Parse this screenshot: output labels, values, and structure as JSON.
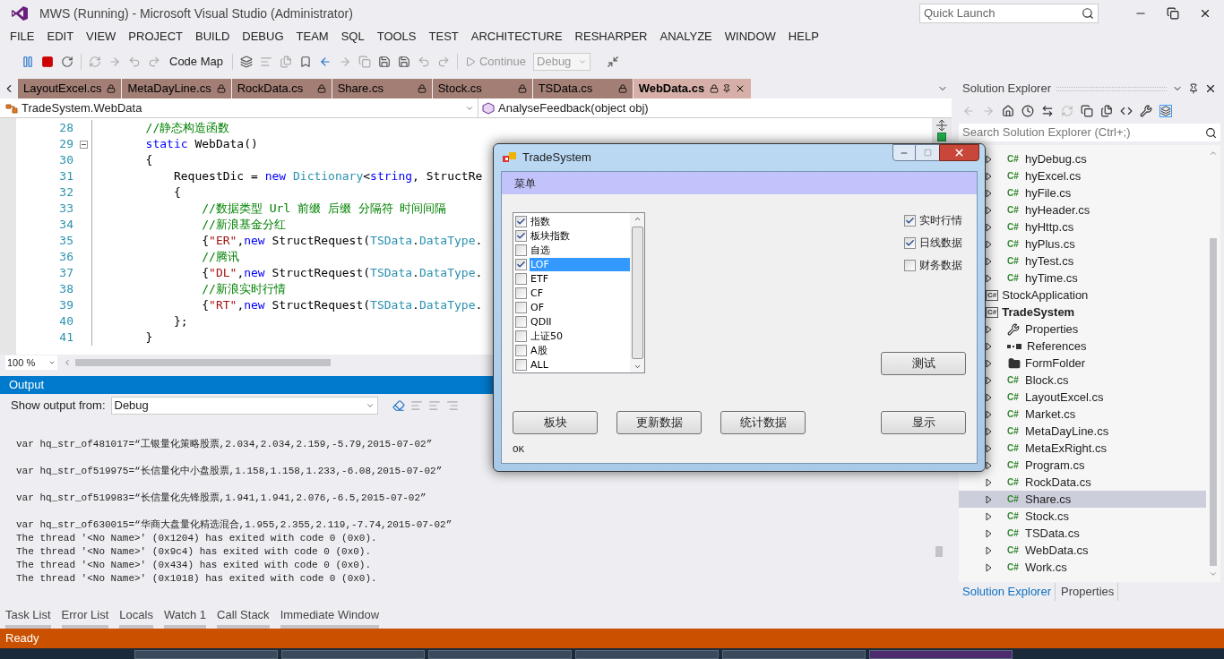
{
  "window": {
    "title": "MWS (Running) - Microsoft Visual Studio (Administrator)",
    "quick_launch": {
      "placeholder": "Quick Launch"
    }
  },
  "menu": [
    "FILE",
    "EDIT",
    "VIEW",
    "PROJECT",
    "BUILD",
    "DEBUG",
    "TEAM",
    "SQL",
    "TOOLS",
    "TEST",
    "ARCHITECTURE",
    "RESHARPER",
    "ANALYZE",
    "WINDOW",
    "HELP"
  ],
  "toolbar": {
    "code_map": "Code Map",
    "continue": "Continue",
    "config": "Debug"
  },
  "doc_tabs": [
    {
      "label": "LayoutExcel.cs",
      "selected": false
    },
    {
      "label": "MetaDayLine.cs",
      "selected": false
    },
    {
      "label": "RockData.cs",
      "selected": false
    },
    {
      "label": "Share.cs",
      "selected": false
    },
    {
      "label": "Stock.cs",
      "selected": false
    },
    {
      "label": "TSData.cs",
      "selected": false
    },
    {
      "label": "WebData.cs",
      "selected": true
    }
  ],
  "nav_bar": {
    "type": "TradeSystem.WebData",
    "member": "AnalyseFeedback(object obj)"
  },
  "code_lines": [
    {
      "number": "28",
      "fold": false,
      "tokens": [
        {
          "text": "        //静态构造函数",
          "kind": "comment"
        }
      ]
    },
    {
      "number": "29",
      "fold": true,
      "tokens": [
        {
          "text": "        static",
          "kind": "keyword"
        },
        {
          "text": " WebData()",
          "kind": "plain"
        }
      ]
    },
    {
      "number": "30",
      "fold": false,
      "tokens": [
        {
          "text": "        {",
          "kind": "plain"
        }
      ]
    },
    {
      "number": "31",
      "fold": false,
      "tokens": [
        {
          "text": "            RequestDic = ",
          "kind": "plain"
        },
        {
          "text": "new",
          "kind": "keyword"
        },
        {
          "text": " Dictionary",
          "kind": "type"
        },
        {
          "text": "<",
          "kind": "plain"
        },
        {
          "text": "string",
          "kind": "keyword"
        },
        {
          "text": ", StructRe",
          "kind": "plain"
        }
      ]
    },
    {
      "number": "32",
      "fold": false,
      "tokens": [
        {
          "text": "            {",
          "kind": "plain"
        }
      ]
    },
    {
      "number": "33",
      "fold": false,
      "tokens": [
        {
          "text": "                //数据类型 Url 前缀 后缀 分隔符 时间间隔",
          "kind": "comment"
        }
      ]
    },
    {
      "number": "34",
      "fold": false,
      "tokens": [
        {
          "text": "                //新浪基金分红",
          "kind": "comment"
        }
      ]
    },
    {
      "number": "35",
      "fold": false,
      "tokens": [
        {
          "text": "                {",
          "kind": "plain"
        },
        {
          "text": "\"ER\"",
          "kind": "string"
        },
        {
          "text": ",",
          "kind": "plain"
        },
        {
          "text": "new",
          "kind": "keyword"
        },
        {
          "text": " StructRequest(",
          "kind": "plain"
        },
        {
          "text": "TSData",
          "kind": "type"
        },
        {
          "text": ".",
          "kind": "plain"
        },
        {
          "text": "DataType",
          "kind": "type"
        },
        {
          "text": ".",
          "kind": "plain"
        }
      ]
    },
    {
      "number": "36",
      "fold": false,
      "tokens": [
        {
          "text": "                //腾讯",
          "kind": "comment"
        }
      ]
    },
    {
      "number": "37",
      "fold": false,
      "tokens": [
        {
          "text": "                {",
          "kind": "plain"
        },
        {
          "text": "\"DL\"",
          "kind": "string"
        },
        {
          "text": ",",
          "kind": "plain"
        },
        {
          "text": "new",
          "kind": "keyword"
        },
        {
          "text": " StructRequest(",
          "kind": "plain"
        },
        {
          "text": "TSData",
          "kind": "type"
        },
        {
          "text": ".",
          "kind": "plain"
        },
        {
          "text": "DataType",
          "kind": "type"
        },
        {
          "text": ".",
          "kind": "plain"
        }
      ]
    },
    {
      "number": "38",
      "fold": false,
      "tokens": [
        {
          "text": "                //新浪实时行情",
          "kind": "comment"
        }
      ]
    },
    {
      "number": "39",
      "fold": false,
      "tokens": [
        {
          "text": "                {",
          "kind": "plain"
        },
        {
          "text": "\"RT\"",
          "kind": "string"
        },
        {
          "text": ",",
          "kind": "plain"
        },
        {
          "text": "new",
          "kind": "keyword"
        },
        {
          "text": " StructRequest(",
          "kind": "plain"
        },
        {
          "text": "TSData",
          "kind": "type"
        },
        {
          "text": ".",
          "kind": "plain"
        },
        {
          "text": "DataType",
          "kind": "type"
        },
        {
          "text": ".",
          "kind": "plain"
        }
      ]
    },
    {
      "number": "40",
      "fold": false,
      "tokens": [
        {
          "text": "            };",
          "kind": "plain"
        }
      ]
    },
    {
      "number": "41",
      "fold": false,
      "tokens": [
        {
          "text": "        }",
          "kind": "plain"
        }
      ]
    }
  ],
  "zoom": "100 %",
  "output": {
    "title": "Output",
    "show_from_label": "Show output from:",
    "source": "Debug",
    "lines": [
      {
        "kind": "data",
        "text": "var hq_str_of481017=“工银量化策略股票,2.034,2.034,2.159,-5.79,2015-07-02”"
      },
      {
        "kind": "data",
        "text": "var hq_str_of519975=“长信量化中小盘股票,1.158,1.158,1.233,-6.08,2015-07-02”"
      },
      {
        "kind": "data",
        "text": "var hq_str_of519983=“长信量化先锋股票,1.941,1.941,2.076,-6.5,2015-07-02”"
      },
      {
        "kind": "data",
        "text": "var hq_str_of630015=“华商大盘量化精选混合,1.955,2.355,2.119,-7.74,2015-07-02”"
      },
      {
        "kind": "log",
        "text": "The thread '<No Name>' (0x1204) has exited with code 0 (0x0)."
      },
      {
        "kind": "log",
        "text": "The thread '<No Name>' (0x9c4) has exited with code 0 (0x0)."
      },
      {
        "kind": "log",
        "text": "The thread '<No Name>' (0x434) has exited with code 0 (0x0)."
      },
      {
        "kind": "log",
        "text": "The thread '<No Name>' (0x1018) has exited with code 0 (0x0)."
      }
    ]
  },
  "tool_tabs": [
    "Task List",
    "Error List",
    "Locals",
    "Watch 1",
    "Call Stack",
    "Immediate Window"
  ],
  "status_bar": "Ready",
  "solution_explorer": {
    "title": "Solution Explorer",
    "search": {
      "placeholder": "Search Solution Explorer (Ctrl+;)"
    },
    "continued_children": [
      {
        "name": "hyDebug.cs",
        "icon_label": "C#",
        "selected": false
      },
      {
        "name": "hyExcel.cs",
        "icon_label": "C#",
        "selected": false
      },
      {
        "name": "hyFile.cs",
        "icon_label": "C#",
        "selected": false
      },
      {
        "name": "hyHeader.cs",
        "icon_label": "C#",
        "selected": false
      },
      {
        "name": "hyHttp.cs",
        "icon_label": "C#",
        "selected": false
      },
      {
        "name": "hyPlus.cs",
        "icon_label": "C#",
        "selected": false
      },
      {
        "name": "hyTest.cs",
        "icon_label": "C#",
        "selected": false
      },
      {
        "name": "hyTime.cs",
        "icon_label": "C#",
        "selected": false
      }
    ],
    "projects": [
      {
        "name": "StockApplication",
        "icon_label": "C#",
        "startup": false,
        "selected": false
      },
      {
        "name": "TradeSystem",
        "icon_label": "C#",
        "startup": true,
        "selected": false,
        "children": [
          {
            "name": "Properties",
            "kind": "properties",
            "selected": false
          },
          {
            "name": "References",
            "kind": "references",
            "selected": false
          },
          {
            "name": "FormFolder",
            "kind": "folder",
            "selected": false
          },
          {
            "name": "Block.cs",
            "kind": "cs",
            "icon_label": "C#",
            "selected": false
          },
          {
            "name": "LayoutExcel.cs",
            "kind": "cs",
            "icon_label": "C#",
            "selected": false
          },
          {
            "name": "Market.cs",
            "kind": "cs",
            "icon_label": "C#",
            "selected": false
          },
          {
            "name": "MetaDayLine.cs",
            "kind": "cs",
            "icon_label": "C#",
            "selected": false
          },
          {
            "name": "MetaExRight.cs",
            "kind": "cs",
            "icon_label": "C#",
            "selected": false
          },
          {
            "name": "Program.cs",
            "kind": "cs",
            "icon_label": "C#",
            "selected": false
          },
          {
            "name": "RockData.cs",
            "kind": "cs",
            "icon_label": "C#",
            "selected": false
          },
          {
            "name": "Share.cs",
            "kind": "cs",
            "icon_label": "C#",
            "selected": true
          },
          {
            "name": "Stock.cs",
            "kind": "cs",
            "icon_label": "C#",
            "selected": false
          },
          {
            "name": "TSData.cs",
            "kind": "cs",
            "icon_label": "C#",
            "selected": false
          },
          {
            "name": "WebData.cs",
            "kind": "cs",
            "icon_label": "C#",
            "selected": false
          },
          {
            "name": "Work.cs",
            "kind": "cs",
            "icon_label": "C#",
            "selected": false
          }
        ]
      }
    ],
    "bottom_tabs": [
      {
        "label": "Solution Explorer",
        "selected": true
      },
      {
        "label": "Properties",
        "selected": false
      }
    ]
  },
  "dialog": {
    "title": "TradeSystem",
    "menu": "菜单",
    "list": [
      {
        "label": "指数",
        "checked": true,
        "selected": false
      },
      {
        "label": "板块指数",
        "checked": true,
        "selected": false
      },
      {
        "label": "自选",
        "checked": false,
        "selected": false
      },
      {
        "label": "LOF",
        "checked": true,
        "selected": true
      },
      {
        "label": "ETF",
        "checked": false,
        "selected": false
      },
      {
        "label": "CF",
        "checked": false,
        "selected": false
      },
      {
        "label": "OF",
        "checked": false,
        "selected": false
      },
      {
        "label": "QDII",
        "checked": false,
        "selected": false
      },
      {
        "label": "上证50",
        "checked": false,
        "selected": false
      },
      {
        "label": "A股",
        "checked": false,
        "selected": false
      },
      {
        "label": "ALL",
        "checked": false,
        "selected": false
      }
    ],
    "options": [
      {
        "label": "实时行情",
        "checked": true
      },
      {
        "label": "日线数据",
        "checked": true
      },
      {
        "label": "财务数据",
        "checked": false
      }
    ],
    "test_button": "测试",
    "buttons": [
      "板块",
      "更新数据",
      "统计数据"
    ],
    "show_button": "显示",
    "status": "OK"
  }
}
